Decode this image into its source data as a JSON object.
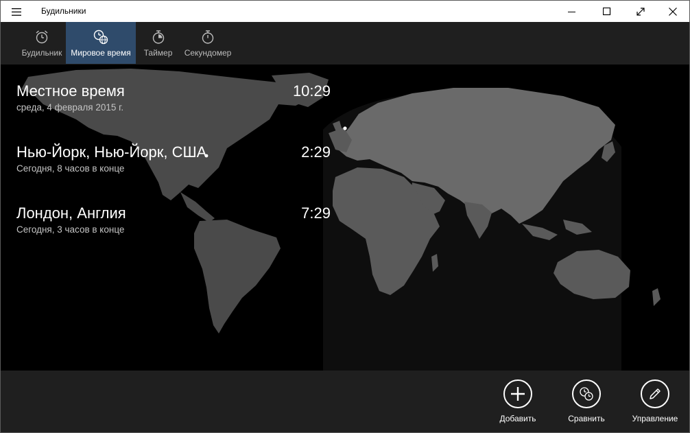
{
  "window": {
    "title": "Будильники"
  },
  "nav": {
    "tabs": [
      {
        "label": "Будильник",
        "icon": "alarm-clock-icon",
        "active": false
      },
      {
        "label": "Мировое время",
        "icon": "world-clock-icon",
        "active": true
      },
      {
        "label": "Таймер",
        "icon": "timer-icon",
        "active": false
      },
      {
        "label": "Секундомер",
        "icon": "stopwatch-icon",
        "active": false
      }
    ]
  },
  "clocks": [
    {
      "city": "Местное время",
      "subtitle": "среда, 4 февраля 2015 г.",
      "time": "10:29"
    },
    {
      "city": "Нью-Йорк, Нью-Йорк, США",
      "subtitle": "Сегодня, 8 часов в конце",
      "time": "2:29"
    },
    {
      "city": "Лондон, Англия",
      "subtitle": "Сегодня, 3 часов в конце",
      "time": "7:29"
    }
  ],
  "commands": {
    "add": "Добавить",
    "compare": "Сравнить",
    "manage": "Управление"
  },
  "colors": {
    "accent_tab": "#2f4b6b",
    "land": "#4a4a4a",
    "daylight_land": "#6a6a6a",
    "background": "#000000",
    "chrome": "#1f1f1f"
  }
}
